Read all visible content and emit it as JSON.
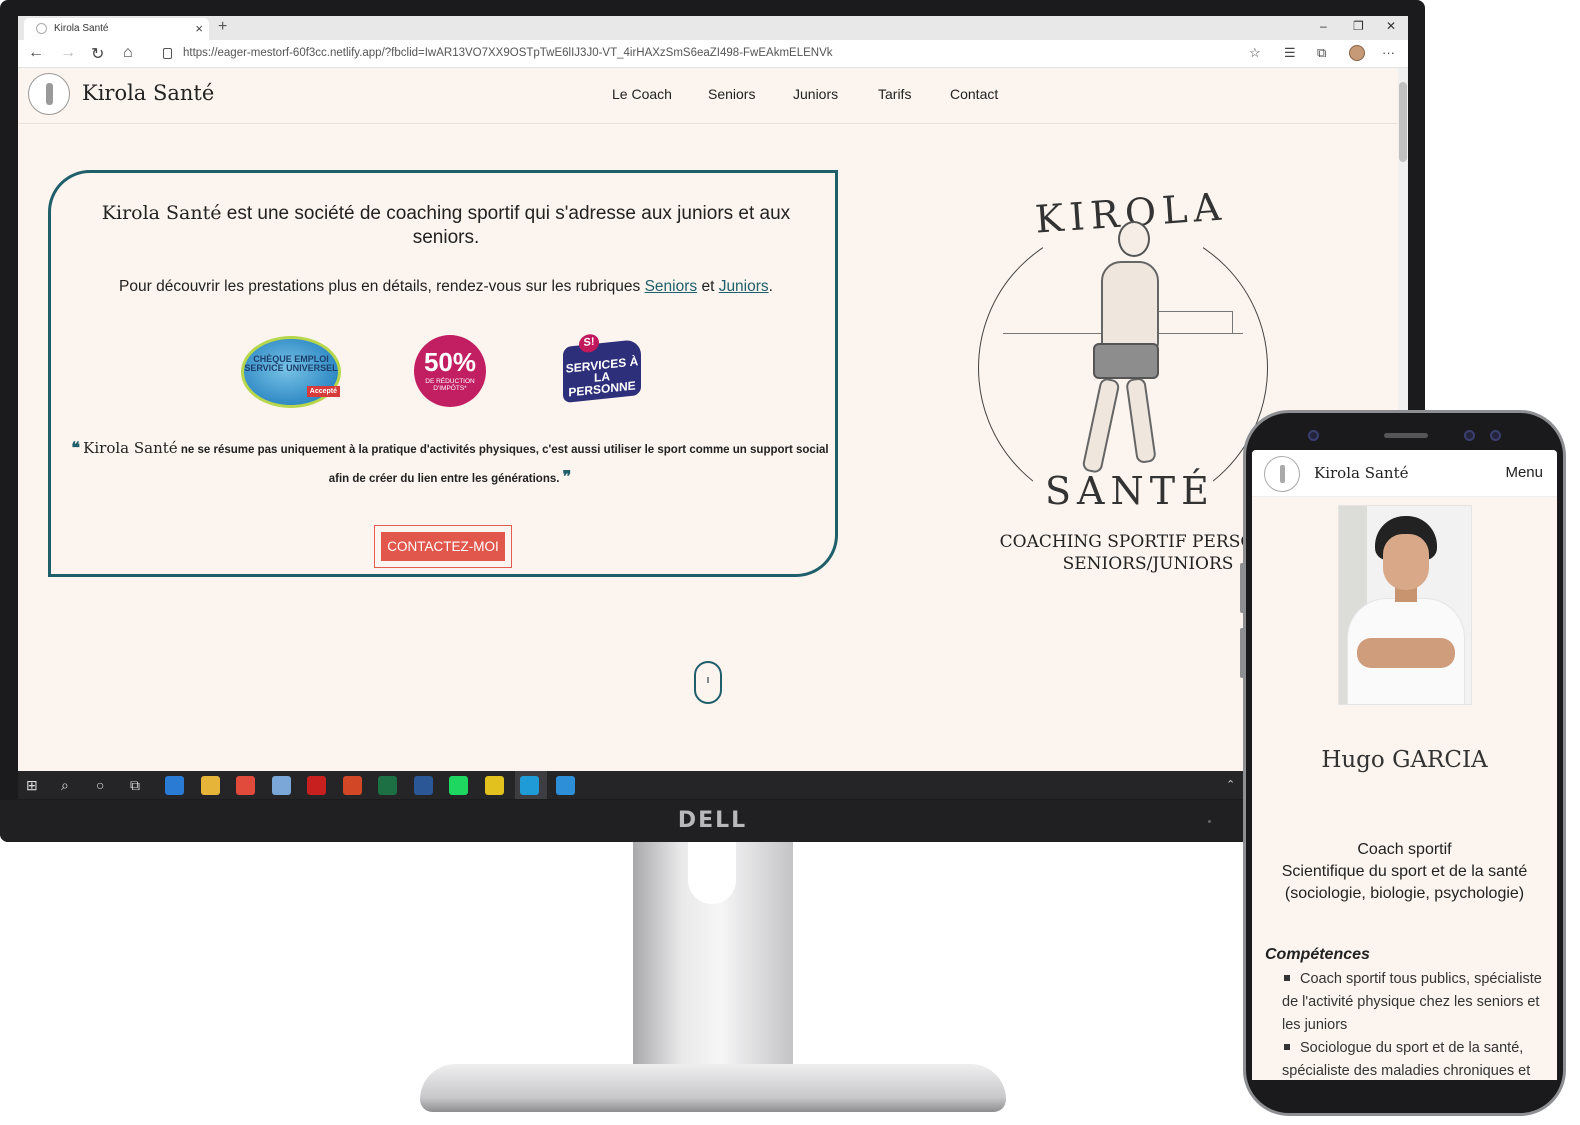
{
  "browser": {
    "tab_title": "Kirola Santé",
    "tab_close": "×",
    "new_tab": "+",
    "url": "https://eager-mestorf-60f3cc.netlify.app/?fbclid=IwAR13VO7XX9OSTpTwE6lIJ3J0-VT_4irHAXzSmS6eaZI498-FwEAkmELENVk",
    "window_controls": [
      "–",
      "❐",
      "✕"
    ]
  },
  "site": {
    "brand": "Kirola Santé",
    "nav": [
      "Le Coach",
      "Seniors",
      "Juniors",
      "Tarifs",
      "Contact"
    ]
  },
  "hero": {
    "brand_inline": "Kirola Santé",
    "headline_rest": " est une société de coaching sportif qui s'adresse aux juniors et aux seniors.",
    "intro_before": "Pour découvrir les prestations plus en détails, rendez-vous sur les rubriques ",
    "link_seniors": "Seniors",
    "intro_mid": " et ",
    "link_juniors": "Juniors",
    "intro_end": ".",
    "badges": {
      "cesu": "CHÈQUE EMPLOI SERVICE UNIVERSEL",
      "cesu_accepted": "Accepté",
      "tax_big": "50%",
      "tax_small": "DE RÉDUCTION D'IMPÔTS*",
      "sap_mark": "S!",
      "sap": "SERVICES À LA PERSONNE"
    },
    "quote_open": "❝",
    "quote_brand": "Kirola Santé",
    "quote_text": " ne se résume pas uniquement à la pratique d'activités physiques, c'est aussi utiliser le sport comme un support social afin de créer du lien entre les générations.",
    "quote_close": "❞",
    "cta": "CONTACTEZ-MOI"
  },
  "logo": {
    "top_word": "KIROLA",
    "bottom_word": "SANTÉ",
    "tagline_line1": "COACHING SPORTIF PERSONNA",
    "tagline_line2": "SENIORS/JUNIORS"
  },
  "monitor": {
    "brand": "DELL"
  },
  "taskbar": {
    "apps": [
      {
        "name": "mail",
        "color": "#2a7bd4"
      },
      {
        "name": "explorer",
        "color": "#e7b43a"
      },
      {
        "name": "chrome",
        "color": "#e04b3c"
      },
      {
        "name": "notes",
        "color": "#7aa6d8"
      },
      {
        "name": "acrobat",
        "color": "#c8201e"
      },
      {
        "name": "powerpoint",
        "color": "#d24726"
      },
      {
        "name": "excel",
        "color": "#1d7044"
      },
      {
        "name": "word",
        "color": "#2b5797"
      },
      {
        "name": "spotify",
        "color": "#1ed760"
      },
      {
        "name": "app",
        "color": "#e2c11e"
      },
      {
        "name": "edge",
        "color": "#1f9cd8"
      },
      {
        "name": "vscode",
        "color": "#2c8fd8"
      }
    ]
  },
  "mobile": {
    "brand": "Kirola Santé",
    "menu": "Menu",
    "name": "Hugo GARCIA",
    "role_line1": "Coach sportif",
    "role_line2": "Scientifique du sport et de la santé",
    "role_line3": "(sociologie, biologie, psychologie)",
    "competences_title": "Compétences",
    "competences": [
      "Coach sportif tous publics, spécialiste de l'activité physique chez les seniors et les juniors",
      "Sociologue du sport et de la santé, spécialiste des maladies chroniques et"
    ]
  },
  "colors": {
    "accent": "#1f5f6b",
    "cta": "#e2574c",
    "page_bg": "#fcf4ee"
  }
}
